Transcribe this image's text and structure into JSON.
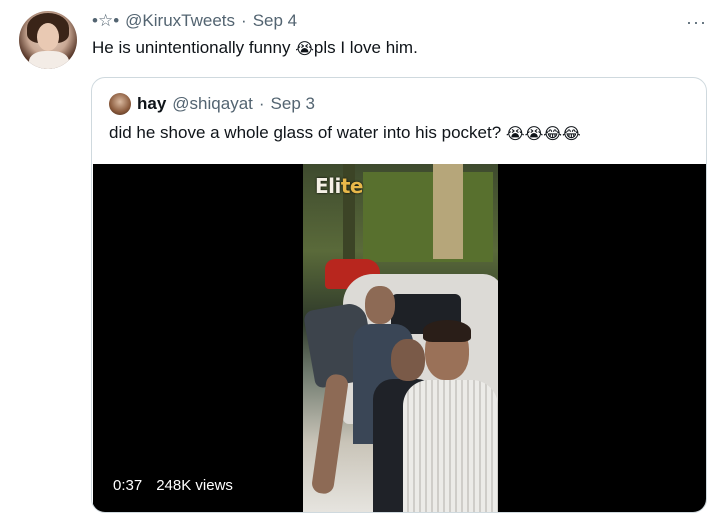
{
  "tweet": {
    "author_name": "•☆•",
    "handle": "@KiruxTweets",
    "separator": "·",
    "date": "Sep 4",
    "more_label": "···",
    "text_before": "He is unintentionally funny ",
    "emoji": "😭",
    "text_after": "pls I love him."
  },
  "quote": {
    "author_name": "hay",
    "handle": "@shiqayat",
    "separator": "·",
    "date": "Sep 3",
    "text": "did he shove a whole glass of water into his pocket? ",
    "emojis": "😭😭😂😂"
  },
  "video": {
    "watermark_main": "Eli",
    "watermark_accent": "te",
    "duration": "0:37",
    "views": "248K views"
  },
  "icons": {
    "more": "more-options-icon",
    "play": "video-player"
  }
}
